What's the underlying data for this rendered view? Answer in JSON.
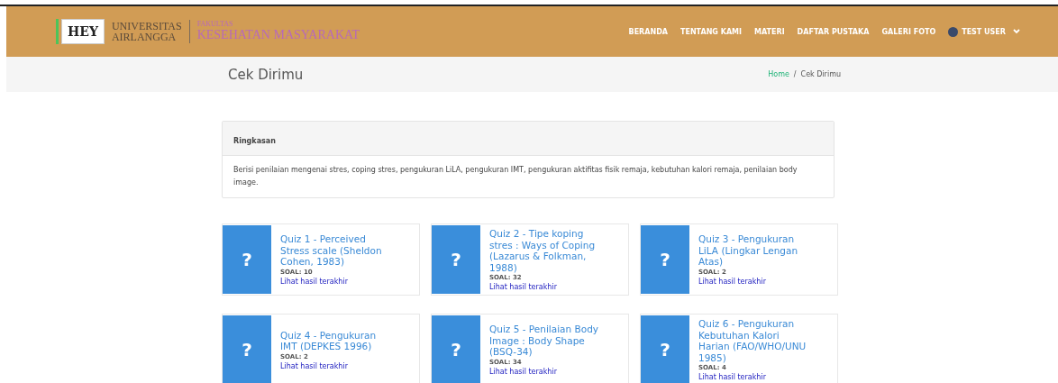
{
  "header": {
    "logo_text": "HEY",
    "university": [
      "UNIVERSITAS",
      "AIRLANGGA"
    ],
    "faculty_small": "FAKULTAS",
    "faculty": "KESEHATAN MASYARAKAT",
    "nav": [
      {
        "label": "BERANDA"
      },
      {
        "label": "TENTANG KAMI"
      },
      {
        "label": "MATERI"
      },
      {
        "label": "DAFTAR PUSTAKA"
      },
      {
        "label": "GALERI FOTO"
      }
    ],
    "user": "TEST USER"
  },
  "page_title": "Cek Dirimu",
  "breadcrumb_separator": "/",
  "breadcrumb": [
    {
      "label": "Home",
      "link": true
    },
    {
      "label": "Cek Dirimu",
      "link": false
    }
  ],
  "summary": {
    "title": "Ringkasan",
    "text": "Berisi penilaian mengenai stres, coping stres, pengukuran LiLA, pengukuran IMT, pengukuran aktifitas fisik remaja, kebutuhan kalori remaja, penilaian body image."
  },
  "quizzes": [
    {
      "icon": "?",
      "title": "Quiz 1 - Perceived Stress scale (Sheldon Cohen, 1983)",
      "count": "SOAL: 10",
      "link": "Lihat hasil terakhir"
    },
    {
      "icon": "?",
      "title": "Quiz 2 - Tipe koping stres : Ways of Coping (Lazarus & Folkman, 1988)",
      "count": "SOAL: 32",
      "link": "Lihat hasil terakhir"
    },
    {
      "icon": "?",
      "title": "Quiz 3 - Pengukuran LiLA (Lingkar Lengan Atas)",
      "count": "SOAL: 2",
      "link": "Lihat hasil terakhir"
    },
    {
      "icon": "?",
      "title": "Quiz 4 - Pengukuran IMT (DEPKES 1996)",
      "count": "SOAL: 2",
      "link": "Lihat hasil terakhir"
    },
    {
      "icon": "?",
      "title": "Quiz 5 - Penilaian Body Image : Body Shape (BSQ-34)",
      "count": "SOAL: 34",
      "link": "Lihat hasil terakhir"
    },
    {
      "icon": "?",
      "title": "Quiz 6 - Pengukuran Kebutuhan Kalori Harian (FAO/WHO/UNU 1985)",
      "count": "SOAL: 4",
      "link": "Lihat hasil terakhir"
    }
  ]
}
